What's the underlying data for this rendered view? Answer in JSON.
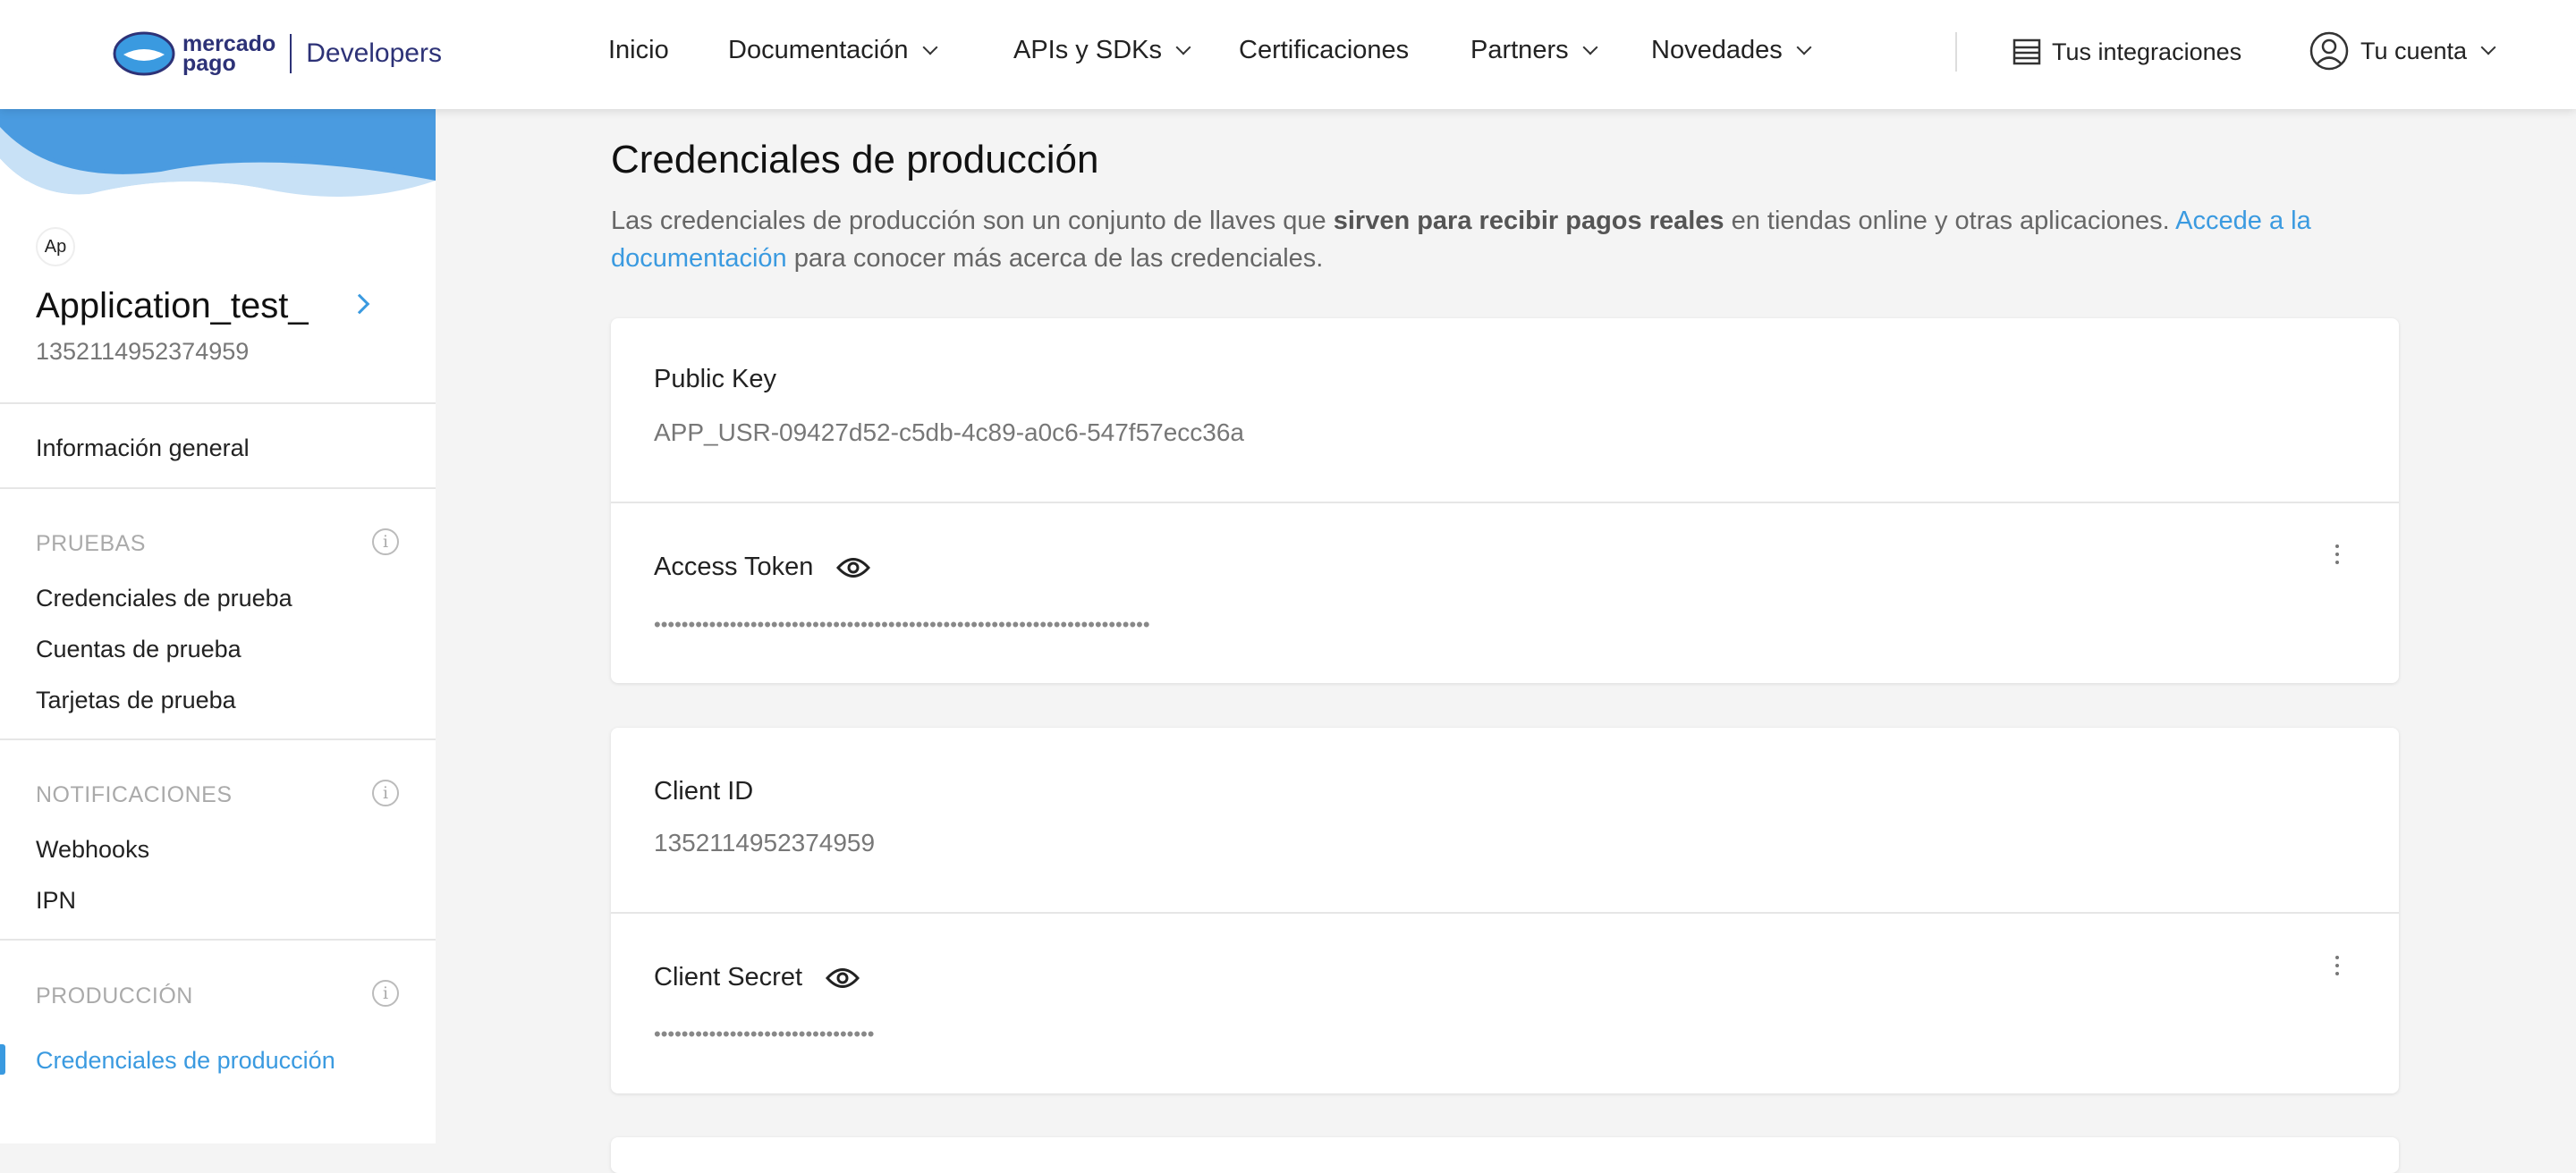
{
  "header": {
    "logo": {
      "brand_line1": "mercado",
      "brand_line2": "pago",
      "product": "Developers"
    },
    "nav": [
      {
        "label": "Inicio",
        "dropdown": false
      },
      {
        "label": "Documentación",
        "dropdown": true
      },
      {
        "label": "APIs y SDKs",
        "dropdown": true
      },
      {
        "label": "Certificaciones",
        "dropdown": false
      },
      {
        "label": "Partners",
        "dropdown": true
      },
      {
        "label": "Novedades",
        "dropdown": true
      }
    ],
    "integrations_label": "Tus integraciones",
    "account_label": "Tu cuenta"
  },
  "sidebar": {
    "app_initials": "Ap",
    "app_name": "Application_test_",
    "app_id": "1352114952374959",
    "general": "Información general",
    "sections": [
      {
        "title": "PRUEBAS",
        "items": [
          "Credenciales de prueba",
          "Cuentas de prueba",
          "Tarjetas de prueba"
        ]
      },
      {
        "title": "NOTIFICACIONES",
        "items": [
          "Webhooks",
          "IPN"
        ]
      },
      {
        "title": "PRODUCCIÓN",
        "items": [
          "Credenciales de producción"
        ]
      }
    ],
    "active_item": "Credenciales de producción"
  },
  "main": {
    "title": "Credenciales de producción",
    "description": {
      "part1": "Las credenciales de producción son un conjunto de llaves que ",
      "bold": "sirven para recibir pagos reales",
      "part2": " en tiendas online y otras aplicaciones. ",
      "link": "Accede a la documentación",
      "part3": " para conocer más acerca de las credenciales."
    },
    "cards": [
      {
        "public_label": "Public Key",
        "public_value": "APP_USR-09427d52-c5db-4c89-a0c6-547f57ecc36a",
        "secret_label": "Access Token",
        "secret_value": "••••••••••••••••••••••••••••••••••••••••••••••••••••••••••••••••••••••••"
      },
      {
        "public_label": "Client ID",
        "public_value": "1352114952374959",
        "secret_label": "Client Secret",
        "secret_value": "••••••••••••••••••••••••••••••••"
      }
    ]
  },
  "colors": {
    "accent": "#3a9ae0",
    "brand_navy": "#2d3277",
    "background": "#f4f4f4"
  }
}
